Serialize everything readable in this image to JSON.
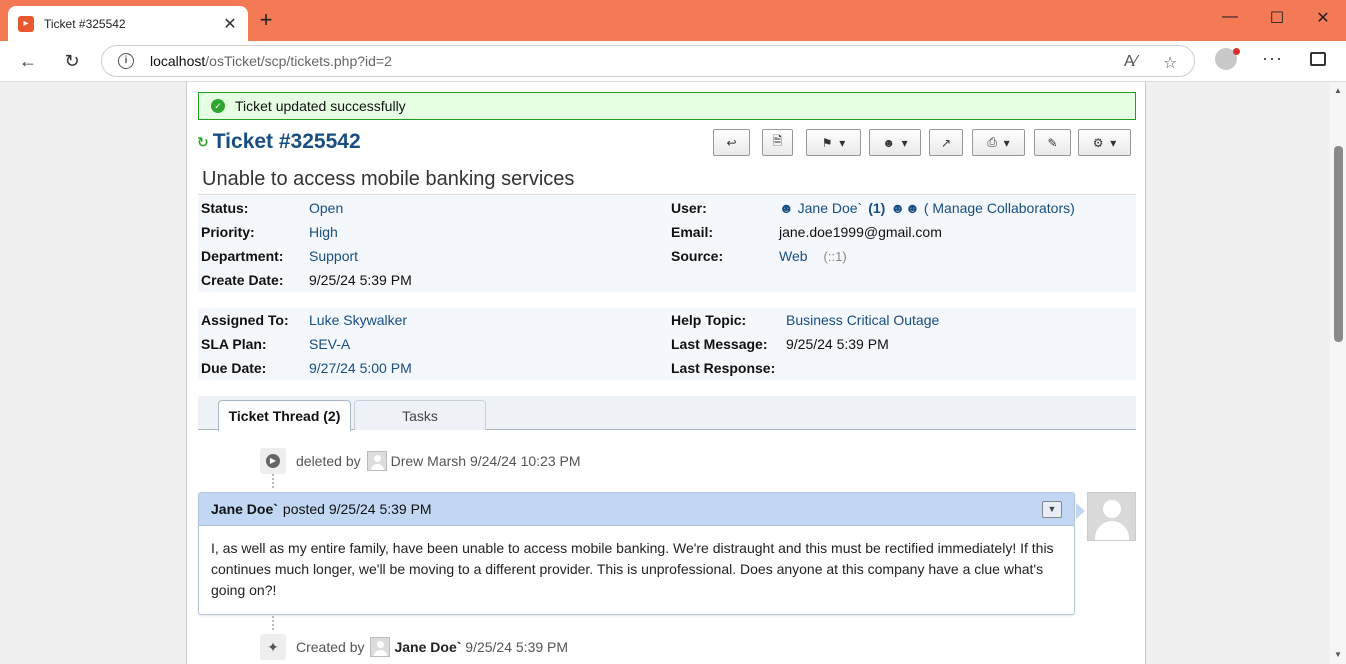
{
  "browser": {
    "tab_title": "Ticket #325542",
    "url_host": "localhost",
    "url_path": "/osTicket/scp/tickets.php?id=2"
  },
  "notice": {
    "text": "Ticket updated successfully"
  },
  "ticket": {
    "number": "Ticket #325542",
    "subject": "Unable to access mobile banking services"
  },
  "info_left": [
    {
      "label": "Status:",
      "value": "Open"
    },
    {
      "label": "Priority:",
      "value": "High"
    },
    {
      "label": "Department:",
      "value": "Support"
    },
    {
      "label": "Create Date:",
      "value": "9/25/24 5:39 PM"
    }
  ],
  "info_right": {
    "user_label": "User:",
    "user_name": "Jane Doe`",
    "user_count": "(1)",
    "manage_collab": "( Manage Collaborators)",
    "email_label": "Email:",
    "email_value": "jane.doe1999@gmail.com",
    "source_label": "Source:",
    "source_value": "Web",
    "source_ip": "(::1)"
  },
  "assign_left": [
    {
      "label": "Assigned To:",
      "value": "Luke Skywalker"
    },
    {
      "label": "SLA Plan:",
      "value": "SEV-A"
    },
    {
      "label": "Due Date:",
      "value": "9/27/24 5:00 PM"
    }
  ],
  "assign_right": [
    {
      "label": "Help Topic:",
      "value": "Business Critical Outage"
    },
    {
      "label": "Last Message:",
      "value": "9/25/24 5:39 PM"
    },
    {
      "label": "Last Response:",
      "value": ""
    }
  ],
  "tabs": {
    "thread": "Ticket Thread (2)",
    "tasks": "Tasks"
  },
  "events": {
    "deleted": {
      "action": "deleted by",
      "who": "Drew Marsh",
      "when": "9/24/24 10:23 PM"
    },
    "created": {
      "action": "Created by",
      "who": "Jane Doe`",
      "when": "9/25/24 5:39 PM"
    }
  },
  "message": {
    "author": "Jane Doe`",
    "posted": "posted 9/25/24 5:39 PM",
    "body": "I, as well as my entire family, have been unable to access mobile banking. We're distraught and this must be rectified immediately! If this continues much longer, we'll be moving to a different provider. This is unprofessional. Does anyone at this company have a clue what's going on?!"
  }
}
